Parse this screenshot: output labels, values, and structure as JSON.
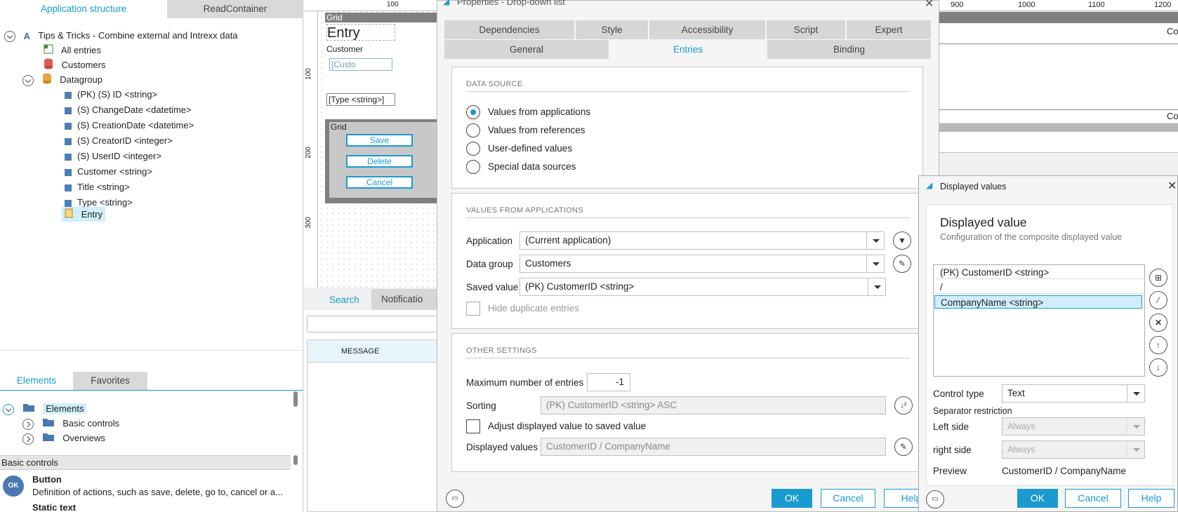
{
  "left": {
    "tabs": [
      "Application structure",
      "ReadContainer"
    ],
    "tree": {
      "root": "Tips & Tricks - Combine external and Intrexx data",
      "all_entries": "All entries",
      "customers": "Customers",
      "datagroup": "Datagroup",
      "fields": [
        "(PK) (S) ID <string>",
        "(S) ChangeDate <datetime>",
        "(S) CreationDate <datetime>",
        "(S) CreatorID <integer>",
        "(S) UserID <integer>",
        "Customer <string>",
        "Title <string>",
        "Type <string>"
      ],
      "entry": "Entry"
    },
    "bottom_tabs": [
      "Elements",
      "Favorites"
    ],
    "elements_tree": {
      "root": "Elements",
      "basic_controls": "Basic controls",
      "overviews": "Overviews"
    },
    "basic_controls_header": "Basic controls",
    "controls": [
      {
        "icon": "OK",
        "title": "Button",
        "desc": "Definition of actions, such as save, delete, go to, cancel or a..."
      },
      {
        "title": "Static text"
      }
    ]
  },
  "canvas": {
    "ruler_top": [
      "100",
      "900",
      "1000",
      "1100",
      "1200"
    ],
    "ruler_left": [
      "100",
      "200",
      "300"
    ],
    "grid_label": "Grid",
    "entry_title": "Entry",
    "customer_label": "Customer",
    "customer_field": "[Custo",
    "type_field": "[Type <string>]",
    "grid2_label": "Grid",
    "buttons": [
      "Save",
      "Delete",
      "Cancel"
    ],
    "bottom_tabs": [
      "Search",
      "Notificatio"
    ],
    "message_col": "MESSAGE",
    "right_text_1": "Co",
    "right_text_2": "Co"
  },
  "props": {
    "title": "Properties - Drop-down list",
    "tabs_row1": [
      "Dependencies",
      "Style",
      "Accessibility",
      "Script",
      "Expert"
    ],
    "tabs_row2": [
      "General",
      "Entries",
      "Binding"
    ],
    "data_source_title": "DATA SOURCE",
    "data_sources": [
      "Values from applications",
      "Values from references",
      "User-defined values",
      "Special data sources"
    ],
    "values_title": "VALUES FROM APPLICATIONS",
    "application_label": "Application",
    "application_value": "(Current application)",
    "datagroup_label": "Data group",
    "datagroup_value": "Customers",
    "saved_label": "Saved value",
    "saved_value": "(PK) CustomerID <string>",
    "hide_dup": "Hide duplicate entries",
    "other_title": "OTHER SETTINGS",
    "max_label": "Maximum number of entries",
    "max_value": "-1",
    "sorting_label": "Sorting",
    "sorting_value": "(PK) CustomerID <string> ASC",
    "adjust_label": "Adjust displayed value to saved value",
    "displayed_label": "Displayed values",
    "displayed_value": "CustomerID / CompanyName",
    "ok": "OK",
    "cancel": "Cancel",
    "help": "Help"
  },
  "dv": {
    "window_title": "Displayed values",
    "heading": "Displayed value",
    "subheading": "Configuration of the composite displayed value",
    "items": [
      "(PK) CustomerID <string>",
      "/",
      "CompanyName <string>"
    ],
    "control_type_label": "Control type",
    "control_type_value": "Text",
    "separator_label": "Separator restriction",
    "left_label": "Left side",
    "left_value": "Always",
    "right_label": "right side",
    "right_value": "Always",
    "preview_label": "Preview",
    "preview_value": "CustomerID / CompanyName",
    "ok": "OK",
    "cancel": "Cancel",
    "help": "Help"
  },
  "colors": {
    "accent": "#1a9bcf",
    "grid_gray": "#7f7f7f"
  }
}
